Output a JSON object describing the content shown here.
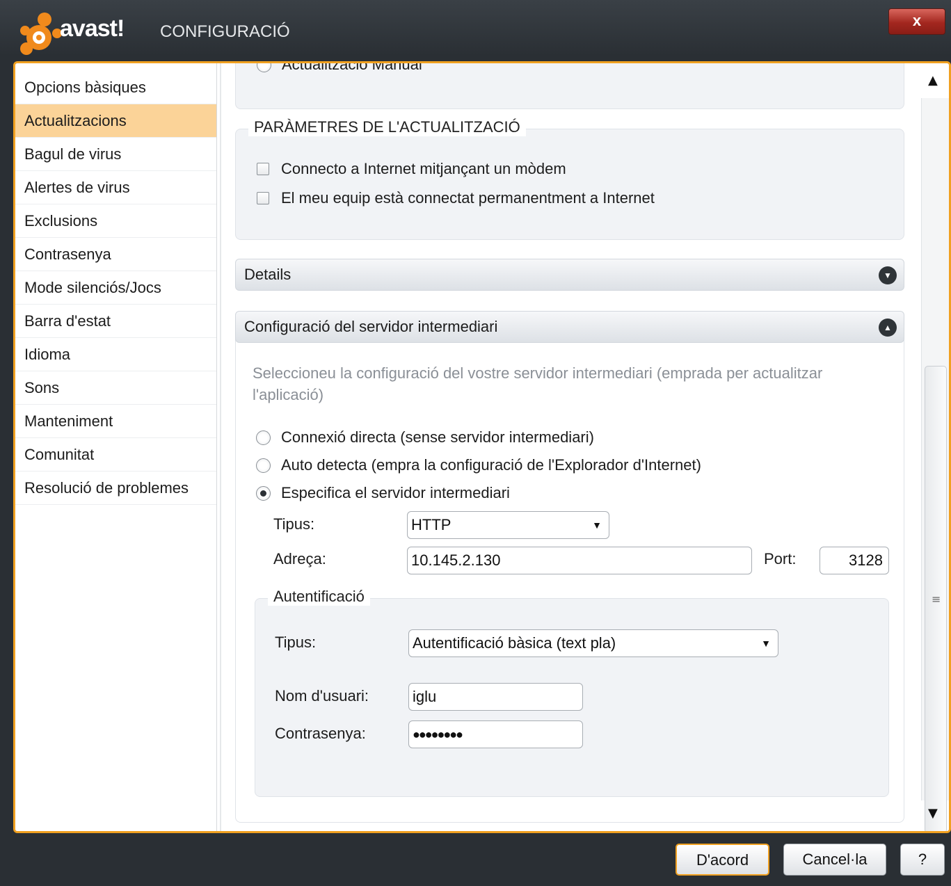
{
  "titlebar": {
    "brand": "avast!",
    "title": "CONFIGURACIÓ",
    "close_label": "x"
  },
  "sidebar": {
    "items": [
      {
        "label": "Opcions bàsiques"
      },
      {
        "label": "Actualitzacions",
        "active": true
      },
      {
        "label": "Bagul de virus"
      },
      {
        "label": "Alertes de virus"
      },
      {
        "label": "Exclusions"
      },
      {
        "label": "Contrasenya"
      },
      {
        "label": "Mode silenciós/Jocs"
      },
      {
        "label": "Barra d'estat"
      },
      {
        "label": "Idioma"
      },
      {
        "label": "Sons"
      },
      {
        "label": "Manteniment"
      },
      {
        "label": "Comunitat"
      },
      {
        "label": "Resolució de problemes"
      }
    ]
  },
  "main": {
    "partial_option": "Actualització Manual",
    "update_params": {
      "legend": "PARÀMETRES DE L'ACTUALITZACIÓ",
      "modem_label": "Connecto a Internet mitjançant un mòdem",
      "permanent_label": "El meu equip està connectat permanentment a Internet"
    },
    "details_header": "Details",
    "proxy": {
      "header": "Configuració del servidor intermediari",
      "description": "Seleccioneu la configuració del vostre servidor intermediari (emprada per actualitzar l'aplicació)",
      "direct_label": "Connexió directa (sense servidor intermediari)",
      "auto_label": "Auto detecta (empra la configuració de l'Explorador d'Internet)",
      "specify_label": "Especifica el servidor intermediari",
      "type_label": "Tipus:",
      "type_value": "HTTP",
      "address_label": "Adreça:",
      "address_value": "10.145.2.130",
      "port_label": "Port:",
      "port_value": "3128"
    },
    "auth": {
      "legend": "Autentificació",
      "type_label": "Tipus:",
      "type_value": "Autentificació bàsica (text pla)",
      "username_label": "Nom d'usuari:",
      "username_value": "iglu",
      "password_label": "Contrasenya:",
      "password_value": "●●●●●●●●"
    }
  },
  "buttons": {
    "ok": "D'acord",
    "cancel": "Cancel·la",
    "help": "?"
  },
  "colors": {
    "accent": "#f0a020",
    "selected_nav": "#fbd398",
    "close": "#a3271f"
  }
}
